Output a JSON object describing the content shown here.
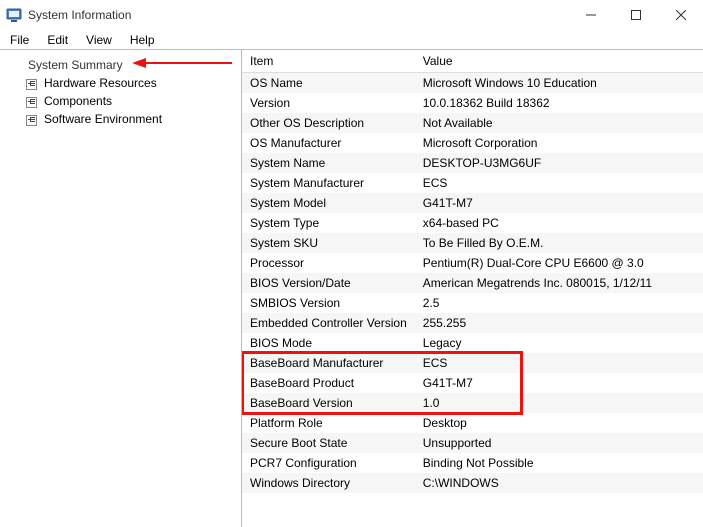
{
  "window": {
    "title": "System Information"
  },
  "menu": [
    "File",
    "Edit",
    "View",
    "Help"
  ],
  "tree": {
    "root": "System Summary",
    "children": [
      "Hardware Resources",
      "Components",
      "Software Environment"
    ]
  },
  "table": {
    "headers": [
      "Item",
      "Value"
    ],
    "rows": [
      {
        "item": "OS Name",
        "value": "Microsoft Windows 10 Education"
      },
      {
        "item": "Version",
        "value": "10.0.18362 Build 18362"
      },
      {
        "item": "Other OS Description",
        "value": "Not Available"
      },
      {
        "item": "OS Manufacturer",
        "value": "Microsoft Corporation"
      },
      {
        "item": "System Name",
        "value": "DESKTOP-U3MG6UF"
      },
      {
        "item": "System Manufacturer",
        "value": "ECS"
      },
      {
        "item": "System Model",
        "value": "G41T-M7"
      },
      {
        "item": "System Type",
        "value": "x64-based PC"
      },
      {
        "item": "System SKU",
        "value": "To Be Filled By O.E.M."
      },
      {
        "item": "Processor",
        "value": "Pentium(R) Dual-Core  CPU      E6600  @ 3.0"
      },
      {
        "item": "BIOS Version/Date",
        "value": "American Megatrends Inc. 080015, 1/12/11"
      },
      {
        "item": "SMBIOS Version",
        "value": "2.5"
      },
      {
        "item": "Embedded Controller Version",
        "value": "255.255"
      },
      {
        "item": "BIOS Mode",
        "value": "Legacy"
      },
      {
        "item": "BaseBoard Manufacturer",
        "value": "ECS"
      },
      {
        "item": "BaseBoard Product",
        "value": "G41T-M7"
      },
      {
        "item": "BaseBoard Version",
        "value": "1.0"
      },
      {
        "item": "Platform Role",
        "value": "Desktop"
      },
      {
        "item": "Secure Boot State",
        "value": "Unsupported"
      },
      {
        "item": "PCR7 Configuration",
        "value": "Binding Not Possible"
      },
      {
        "item": "Windows Directory",
        "value": "C:\\WINDOWS"
      }
    ]
  },
  "highlight": {
    "from_row": 14,
    "to_row": 16
  },
  "colors": {
    "arrow": "#e11",
    "highlight": "#e11"
  }
}
